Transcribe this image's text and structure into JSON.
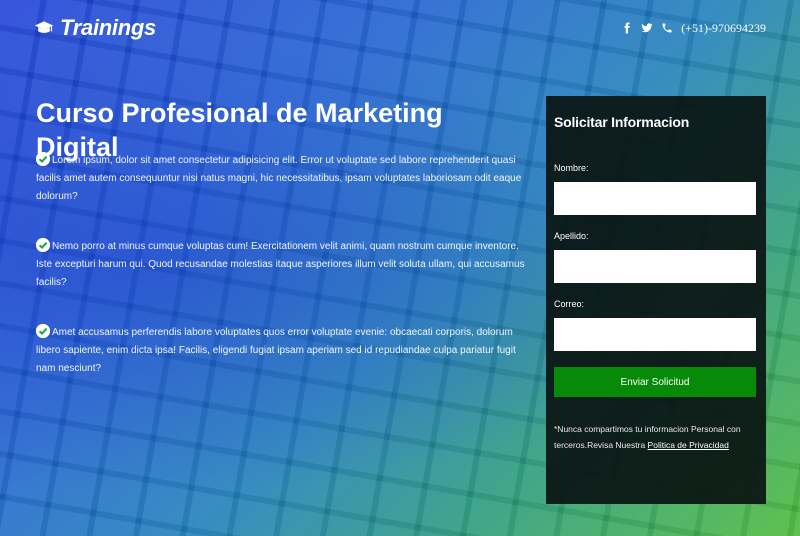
{
  "header": {
    "brand": "Trainings",
    "phone": "(+51)-970694239",
    "social_icons": [
      "facebook-icon",
      "twitter-icon",
      "phone-icon"
    ]
  },
  "hero": {
    "title": "Curso Profesional de Marketing Digital",
    "points": [
      "Lorem ipsum, dolor sit amet consectetur adipisicing elit. Error ut voluptate sed labore reprehenderit quasi facilis amet autem consequuntur nisi natus magni, hic necessitatibus, ipsam voluptates laboriosam odit eaque dolorum?",
      "Nemo porro at minus cumque voluptas cum! Exercitationem velit animi, quam nostrum cumque inventore. Iste excepturi harum qui. Quod recusandae molestias itaque asperiores illum velit soluta ullam, qui accusamus facilis?",
      "Amet accusamus perferendis labore voluptates quos error voluptate evenie: obcaecati corporis, dolorum libero sapiente, enim dicta ipsa! Facilis, eligendi fugiat ipsam aperiam sed id repudiandae culpa pariatur fugit nam nesciunt?"
    ]
  },
  "form": {
    "title": "Solicitar Informacion",
    "fields": [
      {
        "label": "Nombre:",
        "value": ""
      },
      {
        "label": "Apellido:",
        "value": ""
      },
      {
        "label": "Correo:",
        "value": ""
      }
    ],
    "submit_label": "Enviar Solicitud",
    "note_text": "*Nunca compartimos tu informacion Personal con terceros.Revisa Nuestra",
    "privacy_link": "Politica de Privacidad"
  },
  "colors": {
    "submit": "#078a07",
    "panel": "#0a1412"
  }
}
